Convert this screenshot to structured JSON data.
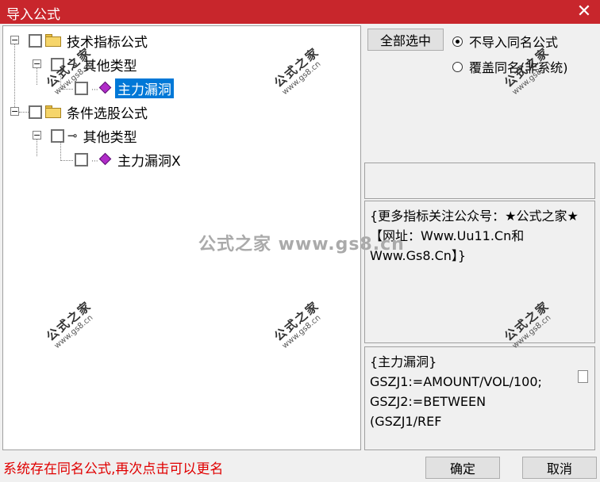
{
  "window": {
    "title": "导入公式",
    "close_glyph": "✕"
  },
  "tree": {
    "nodes": [
      {
        "label": "技术指标公式"
      },
      {
        "label": "其他类型"
      },
      {
        "label": "主力漏洞"
      },
      {
        "label": "条件选股公式"
      },
      {
        "label": "其他类型"
      },
      {
        "label": "主力漏洞X"
      }
    ]
  },
  "options": {
    "select_all_label": "全部选中",
    "radio_no_import": "不导入同名公式",
    "radio_overwrite": "覆盖同名(非系统)",
    "selected": "no_import"
  },
  "description": "{更多指标关注公众号：★公式之家★ 【网址：Www.Uu11.Cn和Www.Gs8.Cn】}",
  "formula_preview": "{主力漏洞}\nGSZJ1:=AMOUNT/VOL/100;\nGSZJ2:=BETWEEN\n(GSZJ1/REF",
  "status_text": "系统存在同名公式,再次点击可以更名",
  "buttons": {
    "ok": "确定",
    "cancel": "取消"
  },
  "watermark": {
    "text": "公式之家",
    "url": "www.gs8.cn",
    "center": "公式之家 www.gs8.cn"
  },
  "colors": {
    "titlebar": "#c8262c",
    "selection": "#0078d7",
    "status": "#e00000"
  }
}
